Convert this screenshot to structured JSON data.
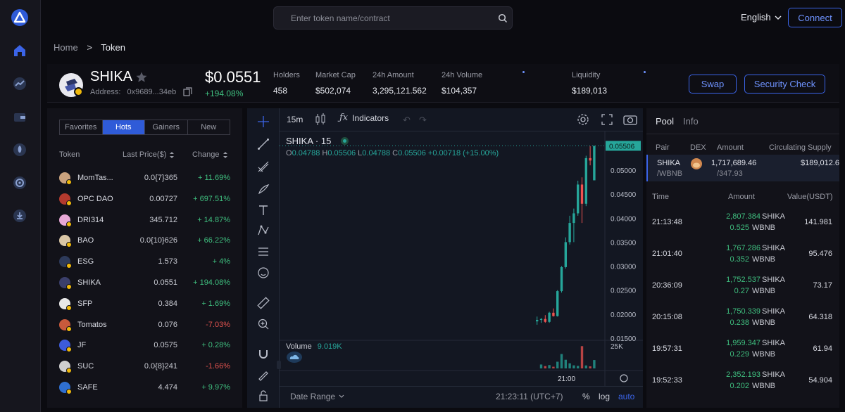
{
  "search": {
    "placeholder": "Enter token name/contract"
  },
  "header": {
    "language": "English",
    "connect_label": "Connect"
  },
  "breadcrumb": {
    "home": "Home",
    "separator": ">",
    "current": "Token"
  },
  "token": {
    "symbol": "SHIKA",
    "address_label": "Address:",
    "address": "0x9689...34eb",
    "price": "$0.0551",
    "change": "+194.08%",
    "stats": [
      {
        "label": "Holders",
        "value": "458"
      },
      {
        "label": "Market Cap",
        "value": "$502,074"
      },
      {
        "label": "24h Amount",
        "value": "3,295,121.562"
      },
      {
        "label": "24h Volume",
        "value": "$104,357"
      },
      {
        "label": "Liquidity",
        "value": "$189,013"
      }
    ],
    "swap_label": "Swap",
    "security_label": "Security Check"
  },
  "list": {
    "tabs": [
      "Favorites",
      "Hots",
      "Gainers",
      "New"
    ],
    "active_tab": "Hots",
    "headers": {
      "token": "Token",
      "price": "Last Price($)",
      "change": "Change"
    },
    "rows": [
      {
        "name": "MomTas...",
        "price": "0.0{7}365",
        "change": "+ 11.69%",
        "dir": "pos",
        "color": "#c9a27e"
      },
      {
        "name": "OPC DAO",
        "price": "0.00727",
        "change": "+ 697.51%",
        "dir": "pos",
        "color": "#b33a2e"
      },
      {
        "name": "DRI314",
        "price": "345.712",
        "change": "+ 14.87%",
        "dir": "pos",
        "color": "#e7a7d6"
      },
      {
        "name": "BAO",
        "price": "0.0{10}626",
        "change": "+ 66.22%",
        "dir": "pos",
        "color": "#d9c6a5"
      },
      {
        "name": "ESG",
        "price": "1.573",
        "change": "+ 4%",
        "dir": "pos",
        "color": "#2d3a5a"
      },
      {
        "name": "SHIKA",
        "price": "0.0551",
        "change": "+ 194.08%",
        "dir": "pos",
        "color": "#3b3f6b"
      },
      {
        "name": "SFP",
        "price": "0.384",
        "change": "+ 1.69%",
        "dir": "pos",
        "color": "#e8e8e8"
      },
      {
        "name": "Tomatos",
        "price": "0.076",
        "change": "-7.03%",
        "dir": "neg",
        "color": "#c85a3c"
      },
      {
        "name": "JF",
        "price": "0.0575",
        "change": "+ 0.28%",
        "dir": "pos",
        "color": "#3d5bd9"
      },
      {
        "name": "SUC",
        "price": "0.0{8}241",
        "change": "-1.66%",
        "dir": "neg",
        "color": "#d0d0d0"
      },
      {
        "name": "SAFE",
        "price": "4.474",
        "change": "+ 9.97%",
        "dir": "pos",
        "color": "#2f6fd0"
      }
    ]
  },
  "chart": {
    "interval": "15m",
    "indicators_label": "Indicators",
    "symbol": "SHIKA · 15",
    "o_label": "O",
    "o": "0.04788",
    "h_label": "H",
    "h": "0.05506",
    "l_label": "L",
    "l": "0.04788",
    "c_label": "C",
    "c": "0.05506",
    "delta": "+0.00718 (+15.00%)",
    "current_price": "0.05506",
    "volume_label": "Volume",
    "volume_value": "9.019K",
    "volume_tick": "25K",
    "time_tick": "21:00",
    "date_range_label": "Date Range",
    "clock": "21:23:11 (UTC+7)",
    "pct_label": "%",
    "log_label": "log",
    "auto_label": "auto",
    "candle_up_color": "#26a69a",
    "candle_down_color": "#ef5350"
  },
  "chart_data": {
    "type": "candlestick",
    "ylim": [
      0.015,
      0.056
    ],
    "yticks": [
      "0.05000",
      "0.04500",
      "0.04000",
      "0.03500",
      "0.03000",
      "0.02500",
      "0.02000",
      "0.01500"
    ],
    "candles": [
      {
        "o": 0.0185,
        "h": 0.0195,
        "l": 0.0178,
        "c": 0.0188,
        "v": 0
      },
      {
        "o": 0.0188,
        "h": 0.0192,
        "l": 0.0182,
        "c": 0.019,
        "v": 4200
      },
      {
        "o": 0.019,
        "h": 0.0198,
        "l": 0.0182,
        "c": 0.0184,
        "v": 2500
      },
      {
        "o": 0.0184,
        "h": 0.0205,
        "l": 0.0182,
        "c": 0.0203,
        "v": 3600
      },
      {
        "o": 0.0203,
        "h": 0.0212,
        "l": 0.0195,
        "c": 0.0196,
        "v": 1800
      },
      {
        "o": 0.0196,
        "h": 0.025,
        "l": 0.0195,
        "c": 0.0248,
        "v": 7200
      },
      {
        "o": 0.0248,
        "h": 0.03,
        "l": 0.0245,
        "c": 0.0298,
        "v": 15500
      },
      {
        "o": 0.0298,
        "h": 0.036,
        "l": 0.0295,
        "c": 0.035,
        "v": 9300
      },
      {
        "o": 0.035,
        "h": 0.0405,
        "l": 0.0345,
        "c": 0.039,
        "v": 5500
      },
      {
        "o": 0.039,
        "h": 0.042,
        "l": 0.035,
        "c": 0.041,
        "v": 3300
      },
      {
        "o": 0.041,
        "h": 0.0478,
        "l": 0.0405,
        "c": 0.047,
        "v": 2700
      },
      {
        "o": 0.047,
        "h": 0.0485,
        "l": 0.039,
        "c": 0.043,
        "v": 24000
      },
      {
        "o": 0.043,
        "h": 0.053,
        "l": 0.0425,
        "c": 0.0525,
        "v": 3200
      },
      {
        "o": 0.0525,
        "h": 0.055,
        "l": 0.051,
        "c": 0.052,
        "v": 2200
      },
      {
        "o": 0.04788,
        "h": 0.05506,
        "l": 0.04788,
        "c": 0.05506,
        "v": 9019
      }
    ]
  },
  "pool": {
    "tabs": [
      "Pool",
      "Info"
    ],
    "active_tab": "Pool",
    "headers": {
      "pair": "Pair",
      "dex": "DEX",
      "amount": "Amount",
      "supply": "Circulating Supply"
    },
    "pair_base": "SHIKA",
    "pair_quote": "/WBNB",
    "amount_base": "1,717,689.46",
    "amount_quote": "/347.93",
    "supply": "$189,012.6",
    "tx_headers": {
      "time": "Time",
      "amount": "Amount",
      "value": "Value(USDT)"
    },
    "tx": [
      {
        "time": "21:13:48",
        "a1": "2,807.384",
        "s1": "SHIKA",
        "a2": "0.525",
        "s2": "WBNB",
        "value": "141.981"
      },
      {
        "time": "21:01:40",
        "a1": "1,767.286",
        "s1": "SHIKA",
        "a2": "0.352",
        "s2": "WBNB",
        "value": "95.476"
      },
      {
        "time": "20:36:09",
        "a1": "1,752.537",
        "s1": "SHIKA",
        "a2": "0.27",
        "s2": "WBNB",
        "value": "73.17"
      },
      {
        "time": "20:15:08",
        "a1": "1,750.339",
        "s1": "SHIKA",
        "a2": "0.238",
        "s2": "WBNB",
        "value": "64.318"
      },
      {
        "time": "19:57:31",
        "a1": "1,959.347",
        "s1": "SHIKA",
        "a2": "0.229",
        "s2": "WBNB",
        "value": "61.94"
      },
      {
        "time": "19:52:33",
        "a1": "2,352.193",
        "s1": "SHIKA",
        "a2": "0.202",
        "s2": "WBNB",
        "value": "54.904"
      }
    ]
  },
  "colors": {
    "accent": "#3b64e8",
    "positive": "#3fbf7f",
    "negative": "#e0524e"
  }
}
